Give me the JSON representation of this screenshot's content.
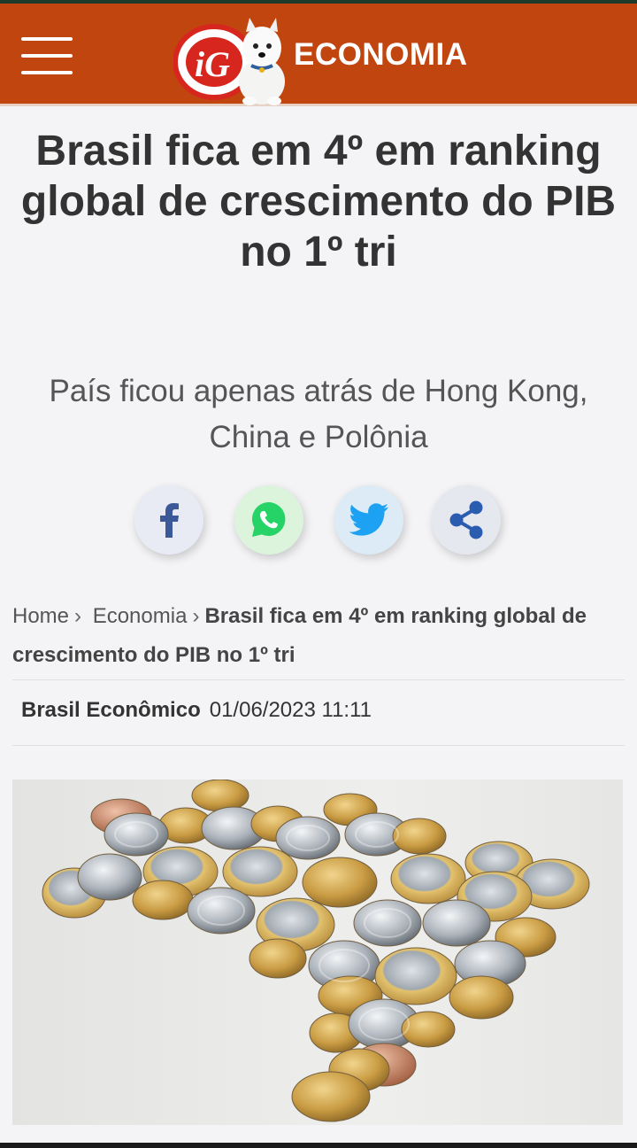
{
  "header": {
    "logo_text": "iG",
    "section": "ECONOMIA",
    "colors": {
      "bar": "#c1450e",
      "logo_red": "#d7261d"
    }
  },
  "article": {
    "title": "Brasil fica em 4º em ranking global de crescimento do PIB no 1º tri",
    "subtitle": "País ficou apenas atrás de Hong Kong, China e Polônia",
    "author": "Brasil Econômico",
    "datetime": "01/06/2023 11:11",
    "image_description_icon": "coins-map-brazil-photo"
  },
  "share": {
    "buttons": [
      {
        "name": "facebook",
        "icon": "facebook-icon"
      },
      {
        "name": "whatsapp",
        "icon": "whatsapp-icon"
      },
      {
        "name": "twitter",
        "icon": "twitter-icon"
      },
      {
        "name": "share",
        "icon": "share-icon"
      }
    ]
  },
  "breadcrumb": {
    "home": "Home",
    "section": "Economia",
    "current": "Brasil fica em 4º em ranking global de crescimento do PIB no 1º tri",
    "separator": "›"
  }
}
